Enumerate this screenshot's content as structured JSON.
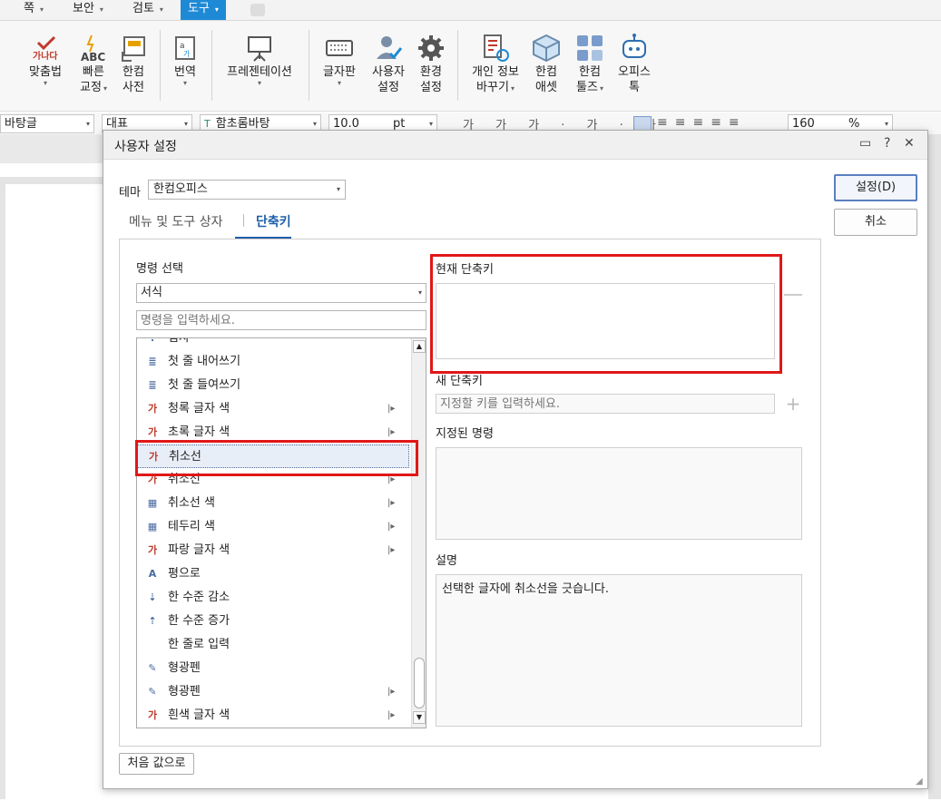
{
  "menubar": {
    "tabs": [
      {
        "label": "쪽"
      },
      {
        "label": "보안"
      },
      {
        "label": "검토"
      },
      {
        "label": "도구",
        "active": true
      }
    ]
  },
  "ribbon": {
    "buttons": [
      {
        "line1": "맞춤법",
        "line2": "",
        "icon": "spellcheck-icon"
      },
      {
        "line1": "빠른",
        "line2": "교정",
        "icon": "quick-correct-icon"
      },
      {
        "line1": "한컴",
        "line2": "사전",
        "icon": "dictionary-icon"
      },
      {
        "line1": "번역",
        "line2": "",
        "icon": "translate-icon"
      },
      {
        "line1": "프레젠테이션",
        "line2": "",
        "icon": "presentation-icon"
      },
      {
        "line1": "글자판",
        "line2": "",
        "icon": "keyboard-icon"
      },
      {
        "line1": "사용자",
        "line2": "설정",
        "icon": "user-settings-icon"
      },
      {
        "line1": "환경",
        "line2": "설정",
        "icon": "gear-icon"
      },
      {
        "line1": "개인 정보",
        "line2": "바꾸기",
        "icon": "personal-info-icon"
      },
      {
        "line1": "한컴",
        "line2": "애셋",
        "icon": "hancom-asset-icon"
      },
      {
        "line1": "한컴",
        "line2": "툴즈",
        "icon": "hancom-tools-icon"
      },
      {
        "line1": "오피스",
        "line2": "톡",
        "icon": "office-talk-icon"
      }
    ]
  },
  "fmtbar": {
    "style": "바탕글",
    "lang": "대표",
    "font": "함초롬바탕",
    "size": "10.0",
    "unit": "pt",
    "zoom": "160",
    "zoom_unit": "%",
    "glyphs": "가 가 가 · 가 · 가"
  },
  "dialog": {
    "title": "사용자 설정",
    "theme_label": "테마",
    "theme_value": "한컴오피스",
    "tabs": [
      "메뉴 및 도구 상자",
      "단축키"
    ],
    "command_select_label": "명령 선택",
    "category_value": "서식",
    "command_placeholder": "명령을 입력하세요.",
    "current_shortcut_label": "현재 단축키",
    "new_shortcut_label": "새 단축키",
    "new_shortcut_placeholder": "지정할 키를 입력하세요.",
    "assigned_label": "지정된 명령",
    "description_label": "설명",
    "description_text": "선택한 글자에 취소선을 긋습니다.",
    "ok_label": "설정(D)",
    "cancel_label": "취소",
    "reset_label": "처음 값으로",
    "commands": [
      {
        "label": "첨자",
        "icon": "!",
        "sub": false
      },
      {
        "label": "첫 줄 내어쓰기",
        "icon": "≣",
        "sub": false
      },
      {
        "label": "첫 줄 들여쓰기",
        "icon": "≣",
        "sub": false
      },
      {
        "label": "청록 글자 색",
        "icon": "가",
        "sub": true
      },
      {
        "label": "초록 글자 색",
        "icon": "가",
        "sub": true
      },
      {
        "label": "취소선",
        "icon": "가",
        "sub": false,
        "selected": true
      },
      {
        "label": "취소선",
        "icon": "가",
        "sub": true
      },
      {
        "label": "취소선 색",
        "icon": "▦",
        "sub": true
      },
      {
        "label": "테두리 색",
        "icon": "▦",
        "sub": true
      },
      {
        "label": "파랑 글자 색",
        "icon": "가",
        "sub": true
      },
      {
        "label": "평으로",
        "icon": "A",
        "sub": false
      },
      {
        "label": "한 수준 감소",
        "icon": "⇣",
        "sub": false
      },
      {
        "label": "한 수준 증가",
        "icon": "⇡",
        "sub": false
      },
      {
        "label": "한 줄로 입력",
        "icon": "",
        "sub": false
      },
      {
        "label": "형광펜",
        "icon": "✎",
        "sub": false
      },
      {
        "label": "형광펜",
        "icon": "✎",
        "sub": true
      },
      {
        "label": "흰색 글자 색",
        "icon": "가",
        "sub": true
      }
    ]
  },
  "colors": {
    "accent": "#1e8ad6",
    "highlight": "#e01818"
  }
}
